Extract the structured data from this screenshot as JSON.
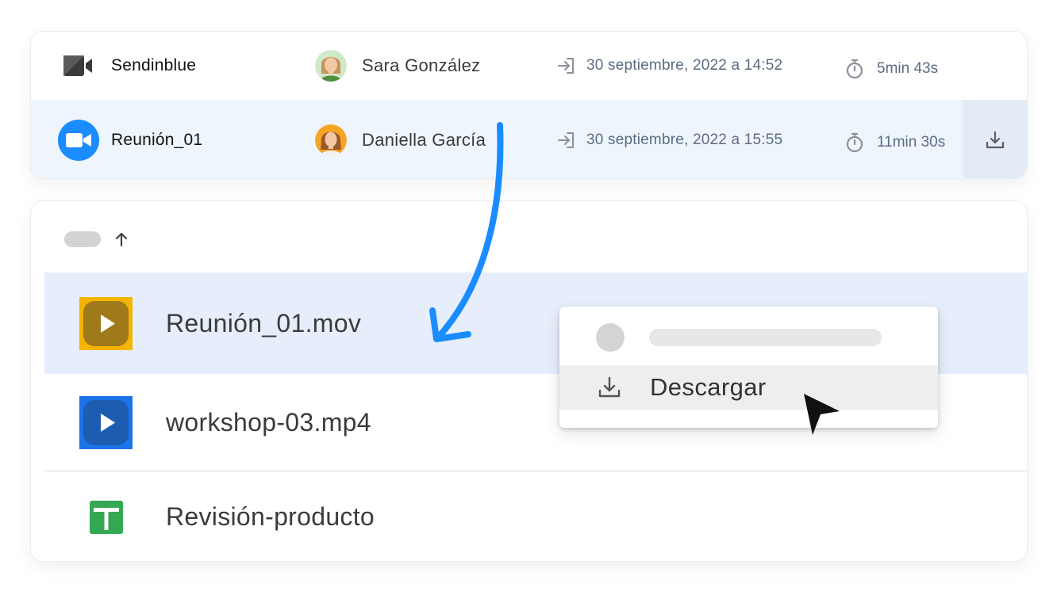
{
  "meetings": [
    {
      "app": "Sendinblue",
      "app_icon": "sendinblue-camera-icon",
      "user": "Sara González",
      "avatar": "avatar-sara",
      "joined_icon": "login-icon",
      "date": "30 septiembre, 2022 a 14:52",
      "timer_icon": "stopwatch-icon",
      "duration": "5min 43s"
    },
    {
      "app": "Reunión_01",
      "app_icon": "zoom-video-icon",
      "user": "Daniella García",
      "avatar": "avatar-daniella",
      "joined_icon": "login-icon",
      "date": "30 septiembre, 2022 a 15:55",
      "timer_icon": "stopwatch-icon",
      "duration": "11min 30s",
      "action_icon": "download-icon"
    }
  ],
  "files": {
    "sort_icon": "arrow-up-icon",
    "items": [
      {
        "name": "Reunión_01.mov",
        "icon": "video-play-icon",
        "color": "#f4b400"
      },
      {
        "name": "workshop-03.mp4",
        "icon": "video-play-icon",
        "color": "#1a73e8"
      },
      {
        "name": "Revisión-producto",
        "icon": "sheets-icon",
        "color": "#34a853"
      }
    ]
  },
  "context_menu": {
    "items": [
      {
        "label": "Descargar",
        "icon": "download-icon"
      }
    ]
  },
  "colors": {
    "highlight_row": "#eef5fd",
    "selected_file_row": "#e6eefb",
    "arrow": "#1a8cff",
    "zoom_blue": "#1a8cff"
  }
}
